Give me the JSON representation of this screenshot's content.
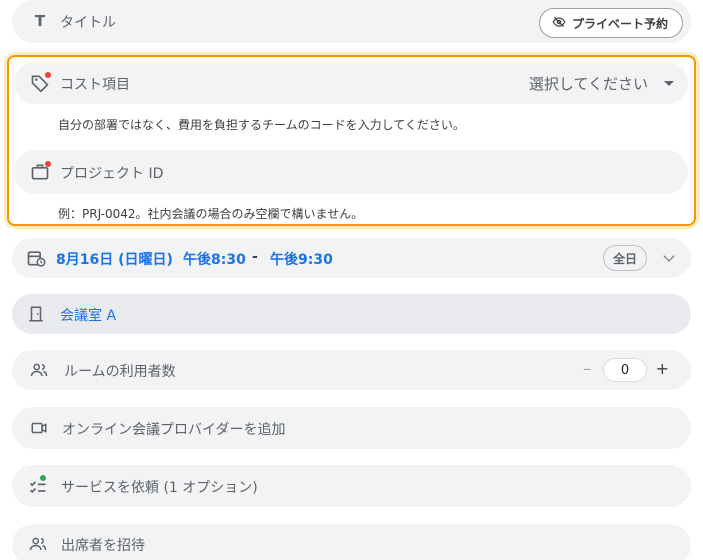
{
  "title_row": {
    "label": "タイトル",
    "private_button": "プライベート予約"
  },
  "custom_fields": {
    "cost_item": {
      "label": "コスト項目",
      "select_value": "選択してください",
      "hint": "自分の部署ではなく、費用を負担するチームのコードを入力してください。"
    },
    "project_id": {
      "label": "プロジェクト ID",
      "hint": "例：PRJ-0042。社内会議の場合のみ空欄で構いません。"
    }
  },
  "datetime": {
    "date": "8月16日 (日曜日)",
    "start": "午後8:30",
    "separator": "-",
    "end": "午後9:30",
    "allday_label": "全日"
  },
  "room": {
    "label": "会議室 A"
  },
  "room_users": {
    "label": "ルームの利用者数",
    "minus": "–",
    "value": "0",
    "plus": "+"
  },
  "online": {
    "label": "オンライン会議プロバイダーを追加"
  },
  "services": {
    "label": "サービスを依頼 (1 オプション)"
  },
  "attendees": {
    "label": "出席者を招待"
  },
  "icons": [
    "title-icon",
    "eye-off-icon",
    "tag-icon",
    "briefcase-icon",
    "calendar-clock-icon",
    "chevron-down-icon",
    "door-icon",
    "people-icon",
    "video-icon",
    "checklist-icon",
    "people-icon"
  ],
  "colors": {
    "accent": "#1a73e8",
    "highlight_border": "#f29900",
    "required_dot": "#ea4335",
    "service_dot": "#34a853"
  }
}
